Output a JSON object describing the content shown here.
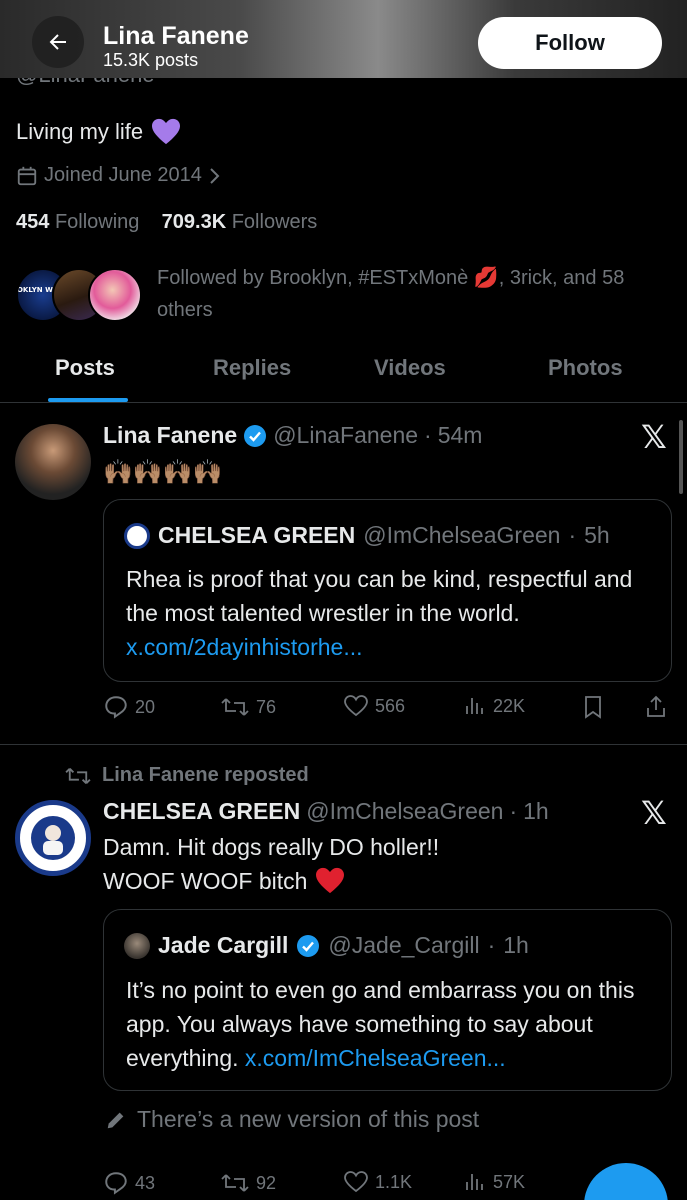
{
  "header": {
    "name": "Lina Fanene",
    "posts_count": "15.3K posts",
    "follow_label": "Follow",
    "handle": "@LinaFanene"
  },
  "profile": {
    "bio": "Living my life",
    "joined": "Joined June 2014",
    "following_count": "454",
    "following_label": "Following",
    "followers_count": "709.3K",
    "followers_label": "Followers",
    "followed_by": "Followed by Brooklyn, #ESTxMonè 💋, 3rick, and 58 others",
    "badge_text": "BROOKLYN WRESTLIN"
  },
  "tabs": [
    {
      "label": "Posts"
    },
    {
      "label": "Replies"
    },
    {
      "label": "Videos"
    },
    {
      "label": "Photos"
    }
  ],
  "post1": {
    "name": "Lina Fanene",
    "handle": "@LinaFanene",
    "time": "54m",
    "text": "🙌🏽🙌🏽🙌🏽🙌🏽",
    "quote": {
      "name": "CHELSEA GREEN",
      "handle": "@ImChelseaGreen",
      "time": "5h",
      "text": "Rhea is proof that you can be kind, respectful and the most talented wrestler in the world.",
      "link": "x.com/2dayinhistorhe..."
    },
    "actions": {
      "replies": "20",
      "reposts": "76",
      "likes": "566",
      "views": "22K"
    }
  },
  "post2": {
    "reposted_by": "Lina Fanene reposted",
    "name": "CHELSEA GREEN",
    "handle": "@ImChelseaGreen",
    "time": "1h",
    "line1": "Damn. Hit dogs really DO holler!!",
    "line2": "WOOF WOOF bitch",
    "quote": {
      "name": "Jade Cargill",
      "handle": "@Jade_Cargill",
      "time": "1h",
      "text": "It’s no point to even go and embarrass you on this app. You always have something to say about everything.",
      "link": "x.com/ImChelseaGreen..."
    },
    "new_version": "There’s a new version of this post",
    "actions": {
      "replies": "43",
      "reposts": "92",
      "likes": "1.1K",
      "views": "57K"
    }
  },
  "colors": {
    "accent": "#1d9bf0",
    "muted": "#71767b",
    "border": "#2f3336",
    "text": "#e7e9ea"
  },
  "icons": [
    "back-arrow-icon",
    "calendar-icon",
    "chevron-right-icon",
    "verified-badge-icon",
    "x-logo-icon",
    "reply-icon",
    "repost-icon",
    "like-icon",
    "views-icon",
    "bookmark-icon",
    "share-icon",
    "pencil-icon",
    "purple-heart-emoji",
    "red-heart-emoji"
  ]
}
